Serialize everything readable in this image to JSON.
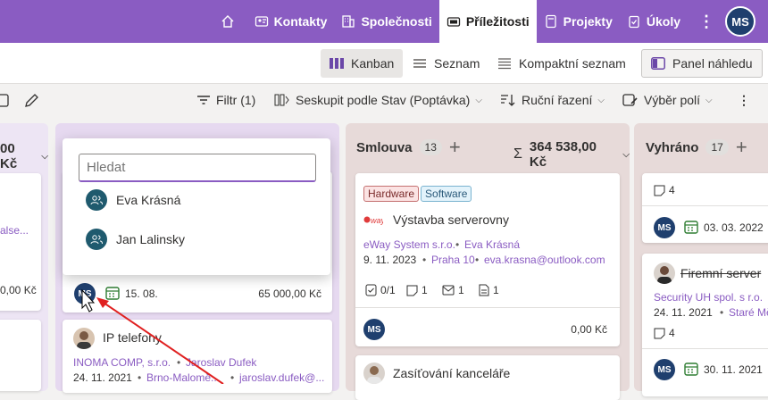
{
  "nav": {
    "items": [
      {
        "label": "Kontakty",
        "icon": "contact-card-icon"
      },
      {
        "label": "Společnosti",
        "icon": "building-icon"
      },
      {
        "label": "Příležitosti",
        "icon": "opportunity-icon",
        "active": true
      },
      {
        "label": "Projekty",
        "icon": "project-icon"
      },
      {
        "label": "Úkoly",
        "icon": "tasks-icon"
      }
    ],
    "avatar": "MS"
  },
  "views": {
    "kanban": "Kanban",
    "list": "Seznam",
    "compact": "Kompaktní seznam",
    "preview": "Panel náhledu"
  },
  "toolbar": {
    "filter": "Filtr (1)",
    "group": "Seskupit podle Stav (Poptávka)",
    "sort": "Ruční řazení",
    "fields": "Výběr polí"
  },
  "col_left": {
    "sum": "00 Kč",
    "link": "alse...",
    "amount": "0,00 Kč"
  },
  "col_mid": {
    "date": "15. 08.",
    "amount": "65 000,00 Kč",
    "avatar": "MS",
    "card2": {
      "title": "IP telefony",
      "company": "INOMA COMP, s.r.o.",
      "person": "Jaroslav Dufek",
      "date": "24. 11. 2021",
      "place": "Brno-Malomě...",
      "email": "jaroslav.dufek@..."
    }
  },
  "dropdown": {
    "placeholder": "Hledat",
    "options": [
      "Eva Krásná",
      "Jan Lalinsky"
    ]
  },
  "col_smlouva": {
    "title": "Smlouva",
    "count": "13",
    "sum": "364 538,00 Kč",
    "card1": {
      "tags": [
        "Hardware",
        "Software"
      ],
      "title": "Výstavba serverovny",
      "company": "eWay System s.r.o.",
      "person": "Eva Krásná",
      "date": "9. 11. 2023",
      "place": "Praha 10",
      "email": "eva.krasna@outlook.com",
      "metrics": [
        "0/1",
        "1",
        "1",
        "1"
      ],
      "avatar": "MS",
      "amount": "0,00 Kč"
    },
    "card2": {
      "title": "Zasíťování kanceláře"
    }
  },
  "col_vyhrano": {
    "title": "Vyhráno",
    "count": "17",
    "card1": {
      "notes": "4",
      "avatar": "MS",
      "date": "03. 03. 2022"
    },
    "card2": {
      "title": "Firemní server",
      "company": "Security UH spol. s r.o.",
      "date": "24. 11. 2021",
      "place": "Staré Měs...",
      "notes": "4",
      "avatar": "MS",
      "date2": "30. 11. 2021"
    }
  },
  "colors": {
    "accent": "#8a5cc2",
    "avatar": "#1f3f6e",
    "arrow": "#e02020"
  }
}
